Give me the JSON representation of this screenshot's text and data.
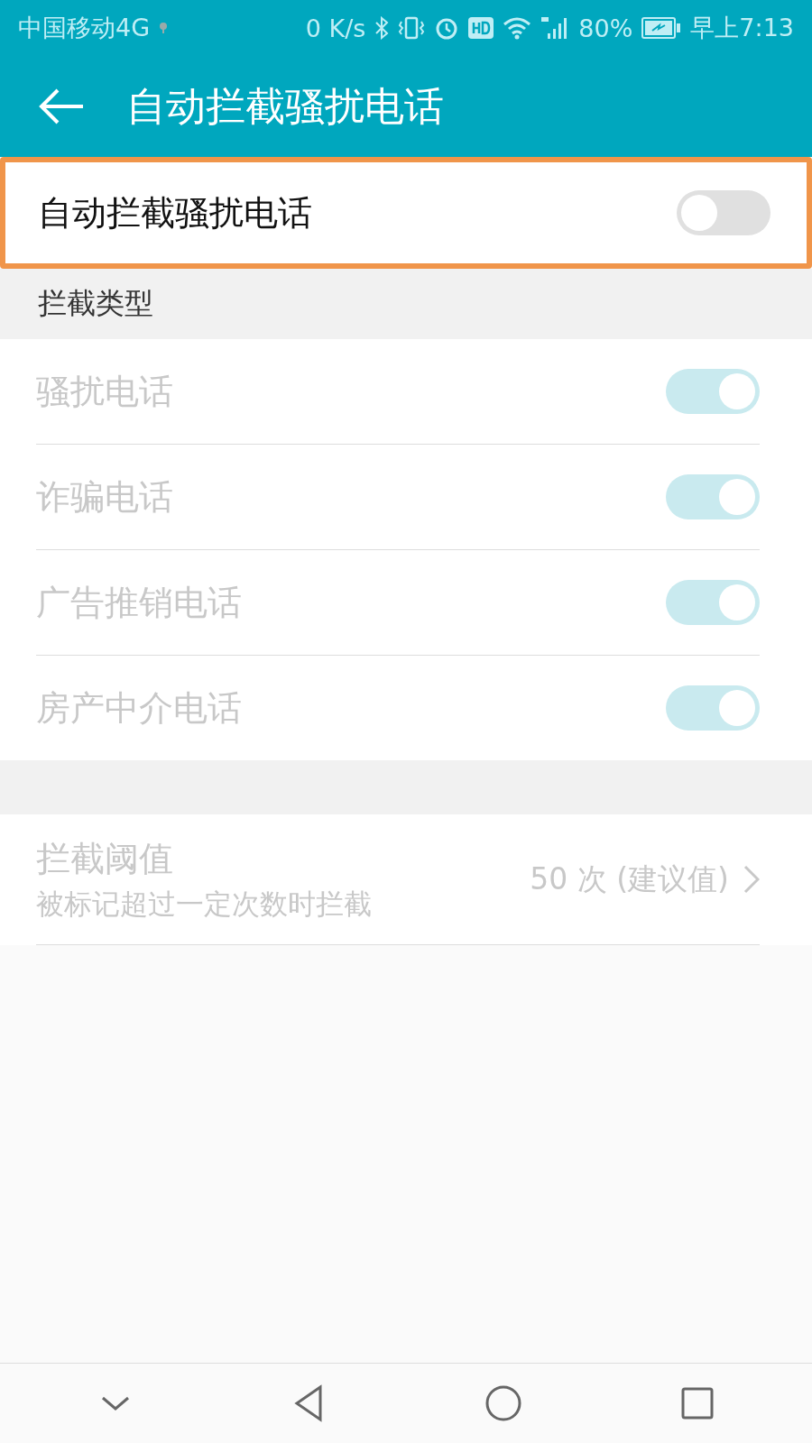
{
  "status_bar": {
    "carrier": "中国移动4G",
    "speed": "0 K/s",
    "battery": "80%",
    "time": "早上7:13"
  },
  "toolbar": {
    "title": "自动拦截骚扰电话"
  },
  "master": {
    "label": "自动拦截骚扰电话",
    "on": false,
    "highlighted": true
  },
  "section": {
    "title": "拦截类型"
  },
  "types": [
    {
      "label": "骚扰电话",
      "on": true,
      "disabled": true
    },
    {
      "label": "诈骗电话",
      "on": true,
      "disabled": true
    },
    {
      "label": "广告推销电话",
      "on": true,
      "disabled": true
    },
    {
      "label": "房产中介电话",
      "on": true,
      "disabled": true
    }
  ],
  "threshold": {
    "title": "拦截阈值",
    "subtitle": "被标记超过一定次数时拦截",
    "value": "50 次 (建议值)",
    "disabled": true
  }
}
